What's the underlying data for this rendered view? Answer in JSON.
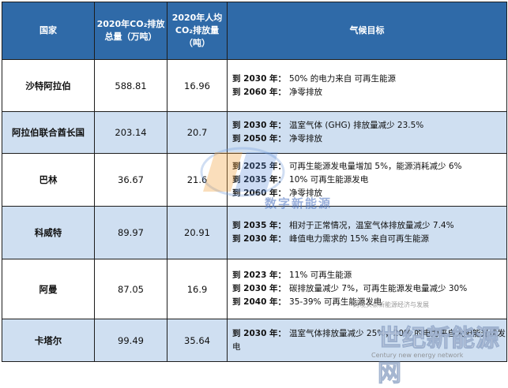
{
  "table": {
    "headers": {
      "country": "国家",
      "total": "2020年CO₂排放总量（万吨）",
      "per_capita": "2020年人均CO₂排放量（吨）",
      "goals": "气候目标"
    },
    "rows": [
      {
        "country": "沙特阿拉伯",
        "total": "588.81",
        "per_capita": "16.96",
        "goals": [
          {
            "year": "到 2030 年：",
            "text": "50% 的电力来自 可再生能源"
          },
          {
            "year": "到 2060 年：",
            "text": "净零排放"
          }
        ]
      },
      {
        "country": "阿拉伯联合酋长国",
        "total": "203.14",
        "per_capita": "20.7",
        "goals": [
          {
            "year": "到 2030 年：",
            "text": "温室气体 (GHG) 排放量减少 23.5%"
          },
          {
            "year": "到 2050 年：",
            "text": "净零排放"
          }
        ]
      },
      {
        "country": "巴林",
        "total": "36.67",
        "per_capita": "21.6",
        "goals": [
          {
            "year": "到 2025 年：",
            "text": "可再生能源发电量增加 5%，能源消耗减少 6%"
          },
          {
            "year": "到 2035 年：",
            "text": "10% 可再生能源发电"
          },
          {
            "year": "到 2060 年：",
            "text": "净零排放"
          }
        ]
      },
      {
        "country": "科威特",
        "total": "89.97",
        "per_capita": "20.91",
        "goals": [
          {
            "year": "到 2035 年：",
            "text": "相对于正常情况，温室气体排放量减少 7.4%"
          },
          {
            "year": "到 2030 年：",
            "text": "峰值电力需求的 15% 来自可再生能源"
          }
        ]
      },
      {
        "country": "阿曼",
        "total": "87.05",
        "per_capita": "16.9",
        "goals": [
          {
            "year": "到 2023 年：",
            "text": "11% 可再生能源"
          },
          {
            "year": "到 2030 年：",
            "text": "碳排放量减少 7%，可再生能源发电量减少 30%"
          },
          {
            "year": "到 2040 年：",
            "text": "35-39% 可再生能源发电"
          }
        ]
      },
      {
        "country": "卡塔尔",
        "total": "99.49",
        "per_capita": "35.64",
        "goals": [
          {
            "year": "到 2030 年：",
            "text": "温室气体排放量减少 25%，20% 的电力来自太阳能光伏发电"
          }
        ]
      }
    ]
  },
  "watermarks": {
    "logo_text": "数字新能源",
    "small_text": "跨境头条新能源经济与发展",
    "big_text": "世纪新能源网",
    "url_text": "Century new energy network"
  }
}
